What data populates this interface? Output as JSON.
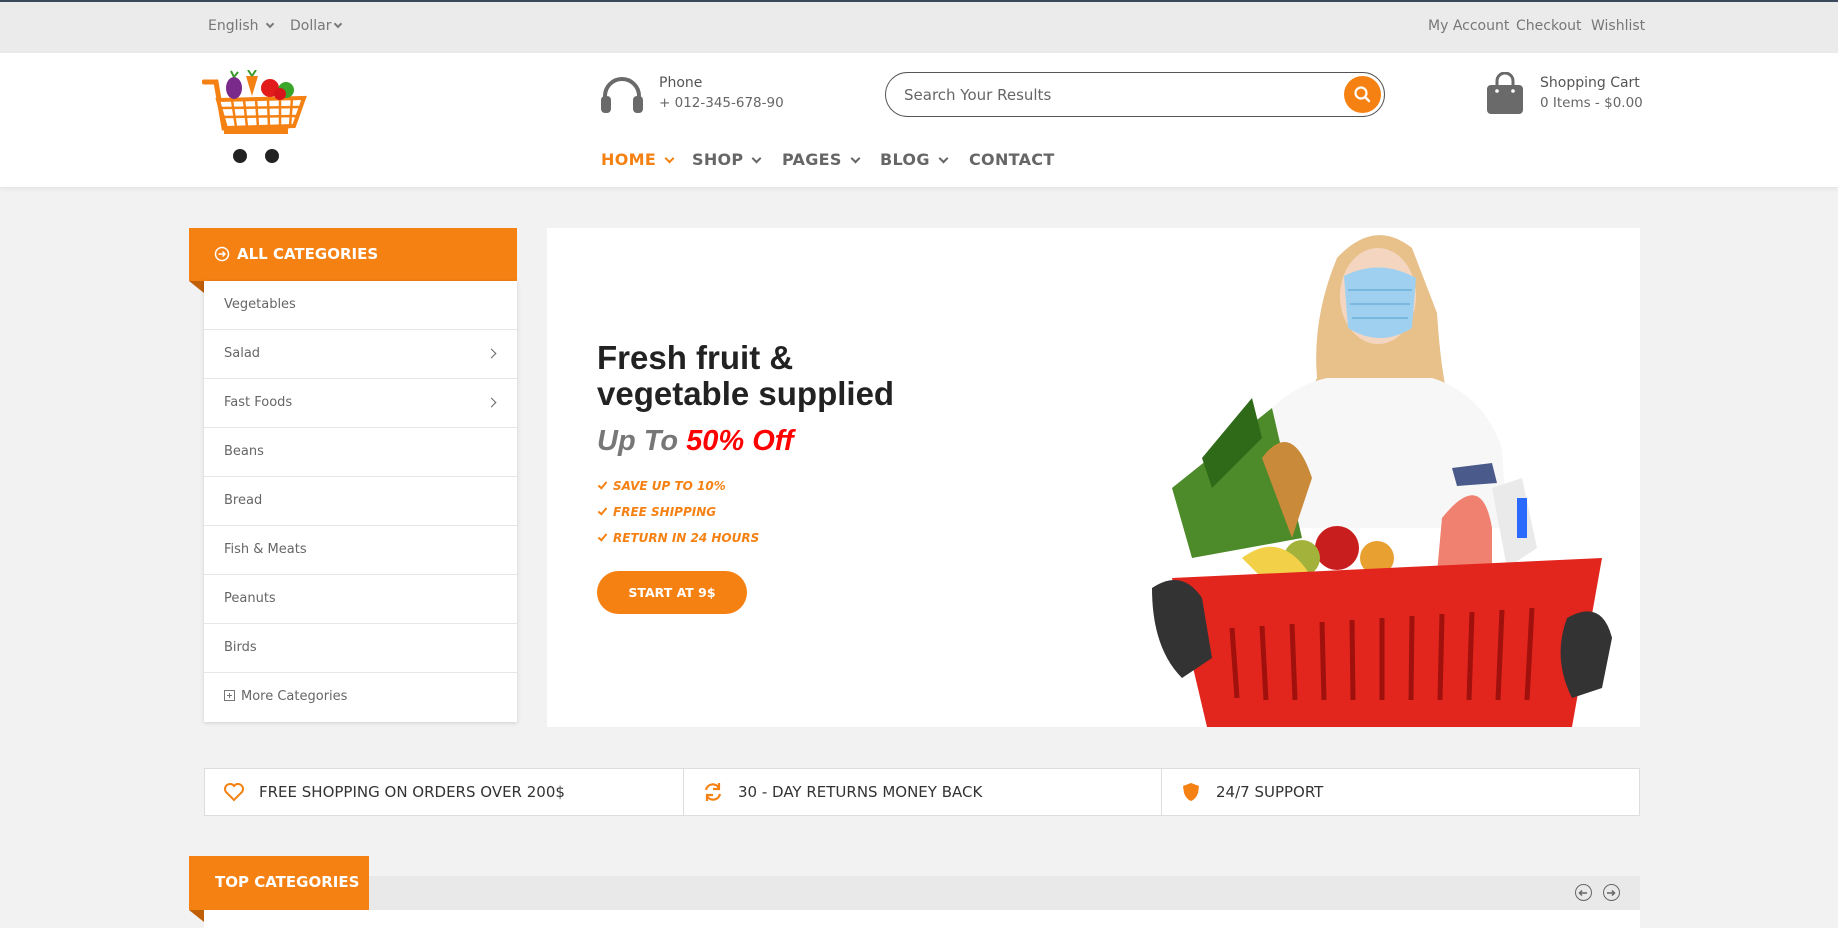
{
  "topbar": {
    "language": "English",
    "currency": "Dollar",
    "links": [
      "My Account",
      "Checkout",
      "Wishlist"
    ]
  },
  "header": {
    "logo_icon": "shopping-cart-with-vegetables-logo",
    "phone": {
      "label": "Phone",
      "number": "+ 012-345-678-90",
      "icon": "headphones-icon"
    },
    "search": {
      "placeholder": "Search Your Results",
      "value": "",
      "icon": "search-icon"
    },
    "cart": {
      "label": "Shopping Cart",
      "summary": "0 Items - $0.00",
      "icon": "shopping-bag-icon"
    },
    "nav": [
      {
        "label": "HOME",
        "active": true,
        "dropdown": true
      },
      {
        "label": "SHOP",
        "active": false,
        "dropdown": true
      },
      {
        "label": "PAGES",
        "active": false,
        "dropdown": true
      },
      {
        "label": "BLOG",
        "active": false,
        "dropdown": true
      },
      {
        "label": "CONTACT",
        "active": false,
        "dropdown": false
      }
    ]
  },
  "categories": {
    "title": "ALL CATEGORIES",
    "items": [
      {
        "label": "Vegetables",
        "submenu": false
      },
      {
        "label": "Salad",
        "submenu": true
      },
      {
        "label": "Fast Foods",
        "submenu": true
      },
      {
        "label": "Beans",
        "submenu": false
      },
      {
        "label": "Bread",
        "submenu": false
      },
      {
        "label": "Fish & Meats",
        "submenu": false
      },
      {
        "label": "Peanuts",
        "submenu": false
      },
      {
        "label": "Birds",
        "submenu": false
      }
    ],
    "more": "More Categories"
  },
  "slider": {
    "heading_line1": "Fresh fruit &",
    "heading_line2": "vegetable supplied",
    "promo_prefix": "Up To",
    "promo_highlight": "50% Off",
    "features": [
      "SAVE UP TO 10%",
      "FREE SHIPPING",
      "RETURN IN 24 HOURS"
    ],
    "button": "START AT 9$",
    "slide_count": 2
  },
  "features_bar": [
    {
      "text": "FREE SHOPPING ON ORDERS OVER 200$",
      "icon": "heart-icon"
    },
    {
      "text": "30 - DAY RETURNS MONEY BACK",
      "icon": "refresh-icon"
    },
    {
      "text": "24/7 SUPPORT",
      "icon": "shield-icon"
    }
  ],
  "top_categories": {
    "title": "TOP CATEGORIES"
  },
  "colors": {
    "accent": "#f58113",
    "highlight_red": "#ff0000",
    "text_dark": "#222222"
  }
}
